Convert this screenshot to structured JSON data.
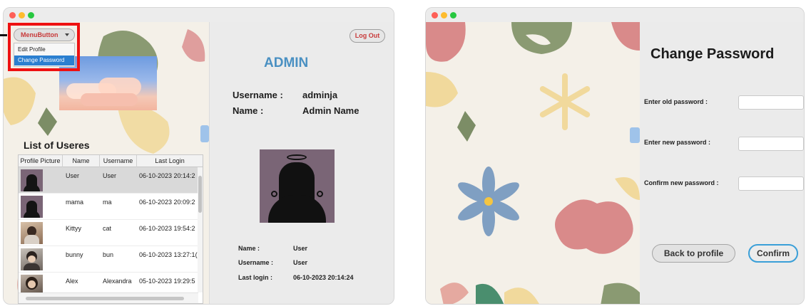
{
  "left_window": {
    "menu_button": {
      "label": "MenuButton",
      "items": [
        "Edit Profile",
        "Change Password"
      ]
    },
    "logout_label": "Log Out",
    "list_title": "List of Useres",
    "table": {
      "columns": [
        "Profile Picture",
        "Name",
        "Username",
        "Last Login"
      ],
      "rows": [
        {
          "name": "User",
          "username": "User",
          "last_login": "06-10-2023 20:14:2"
        },
        {
          "name": "mama",
          "username": "ma",
          "last_login": "06-10-2023 20:09:2"
        },
        {
          "name": "Kittyy",
          "username": "cat",
          "last_login": "06-10-2023 19:54:2"
        },
        {
          "name": "bunny",
          "username": "bun",
          "last_login": "06-10-2023 13:27:1("
        },
        {
          "name": "Alex",
          "username": "Alexandra",
          "last_login": "05-10-2023 19:29:5"
        }
      ]
    },
    "profile": {
      "role_title": "ADMIN",
      "username_label": "Username :",
      "username_value": "adminja",
      "name_label": "Name :",
      "name_value": "Admin Name"
    },
    "selected_user": {
      "name_label": "Name :",
      "name_value": "User",
      "username_label": "Username :",
      "username_value": "User",
      "last_login_label": "Last login :",
      "last_login_value": "06-10-2023 20:14:24"
    }
  },
  "right_window": {
    "title": "Change Password",
    "old_password_label": "Enter old password :",
    "new_password_label": "Enter new password :",
    "confirm_password_label": "Confirm new password :",
    "old_password_value": "",
    "new_password_value": "",
    "confirm_password_value": "",
    "back_label": "Back to profile",
    "confirm_label": "Confirm"
  },
  "colors": {
    "admin_title": "#4a90c2",
    "highlight_box": "#ee1111",
    "menu_selected": "#2b7fd0",
    "menu_button_text": "#c83a3a",
    "confirm_border": "#3a9fd8",
    "traffic_red": "#fe5f57",
    "traffic_yellow": "#febc2e",
    "traffic_green": "#28c840"
  }
}
